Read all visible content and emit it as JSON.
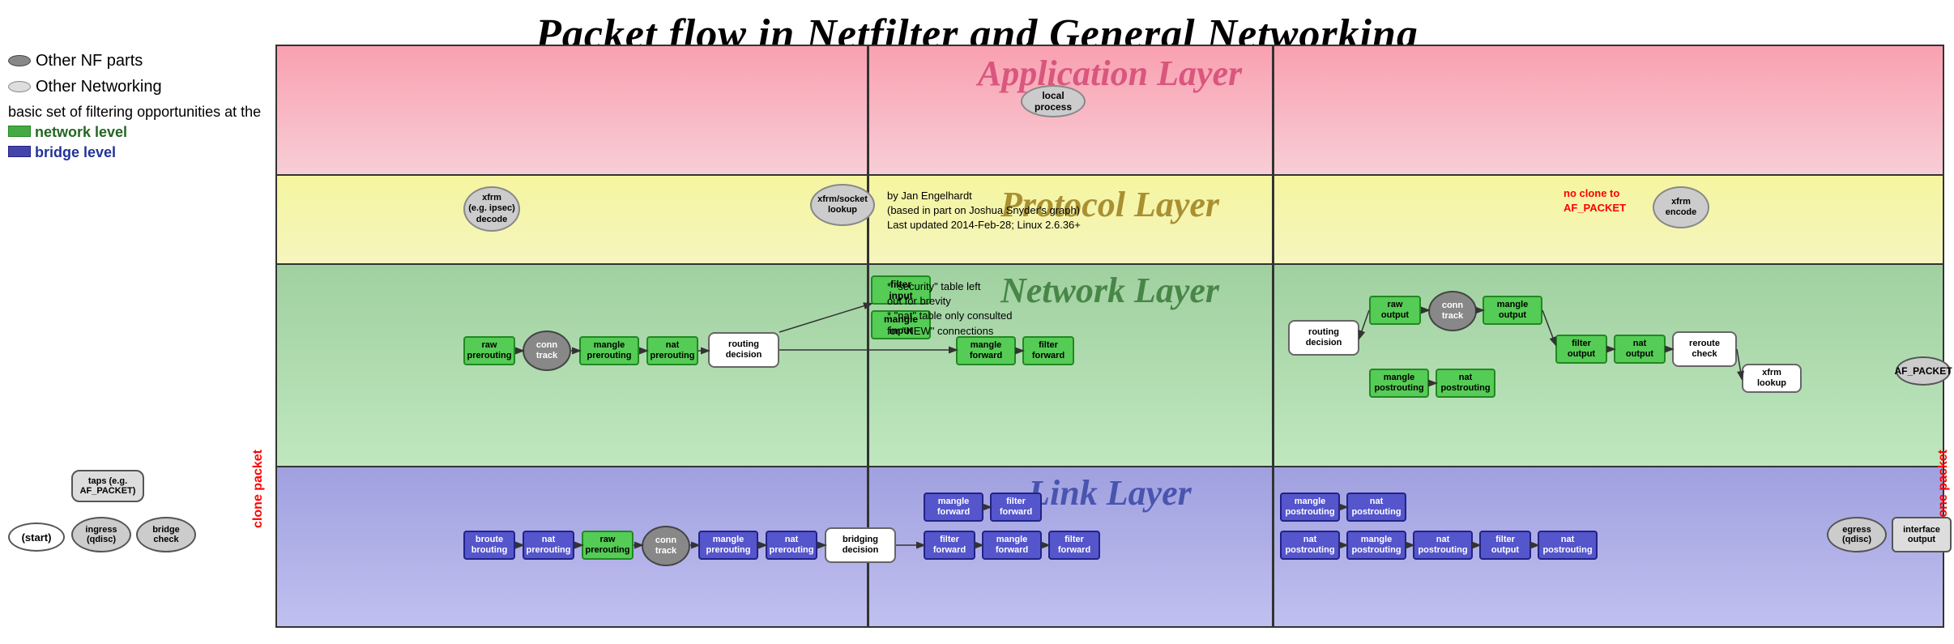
{
  "title": "Packet flow in Netfilter and General Networking",
  "legend": {
    "nf_parts_label": "Other NF parts",
    "networking_label": "Other Networking",
    "filter_desc": "basic set of filtering opportunities at the",
    "network_level": "network level",
    "bridge_level": "bridge level"
  },
  "layers": {
    "application": "Application Layer",
    "protocol": "Protocol Layer",
    "network": "Network Layer",
    "link": "Link Layer"
  },
  "notes": {
    "author": "by Jan Engelhardt",
    "based": "(based in part on Joshua Snyder's graph)",
    "updated": "Last updated 2014-Feb-28; Linux 2.6.36+",
    "security_note": "* \"security\" table left",
    "security_note2": "  out for brevity",
    "nat_note": "* \"nat\" table only consulted",
    "nat_note2": "  for \"NEW\" connections",
    "no_clone": "no clone to",
    "af_packet_ref": "AF_PACKET"
  },
  "colors": {
    "green_node": "#55cc55",
    "blue_node": "#5566dd",
    "gray_node": "#888888",
    "white_node": "#ffffff",
    "app_bg": "#f590a8",
    "proto_bg": "#f0f080",
    "network_bg": "#88cc88",
    "link_bg": "#8888cc",
    "red_label": "#cc0000"
  }
}
